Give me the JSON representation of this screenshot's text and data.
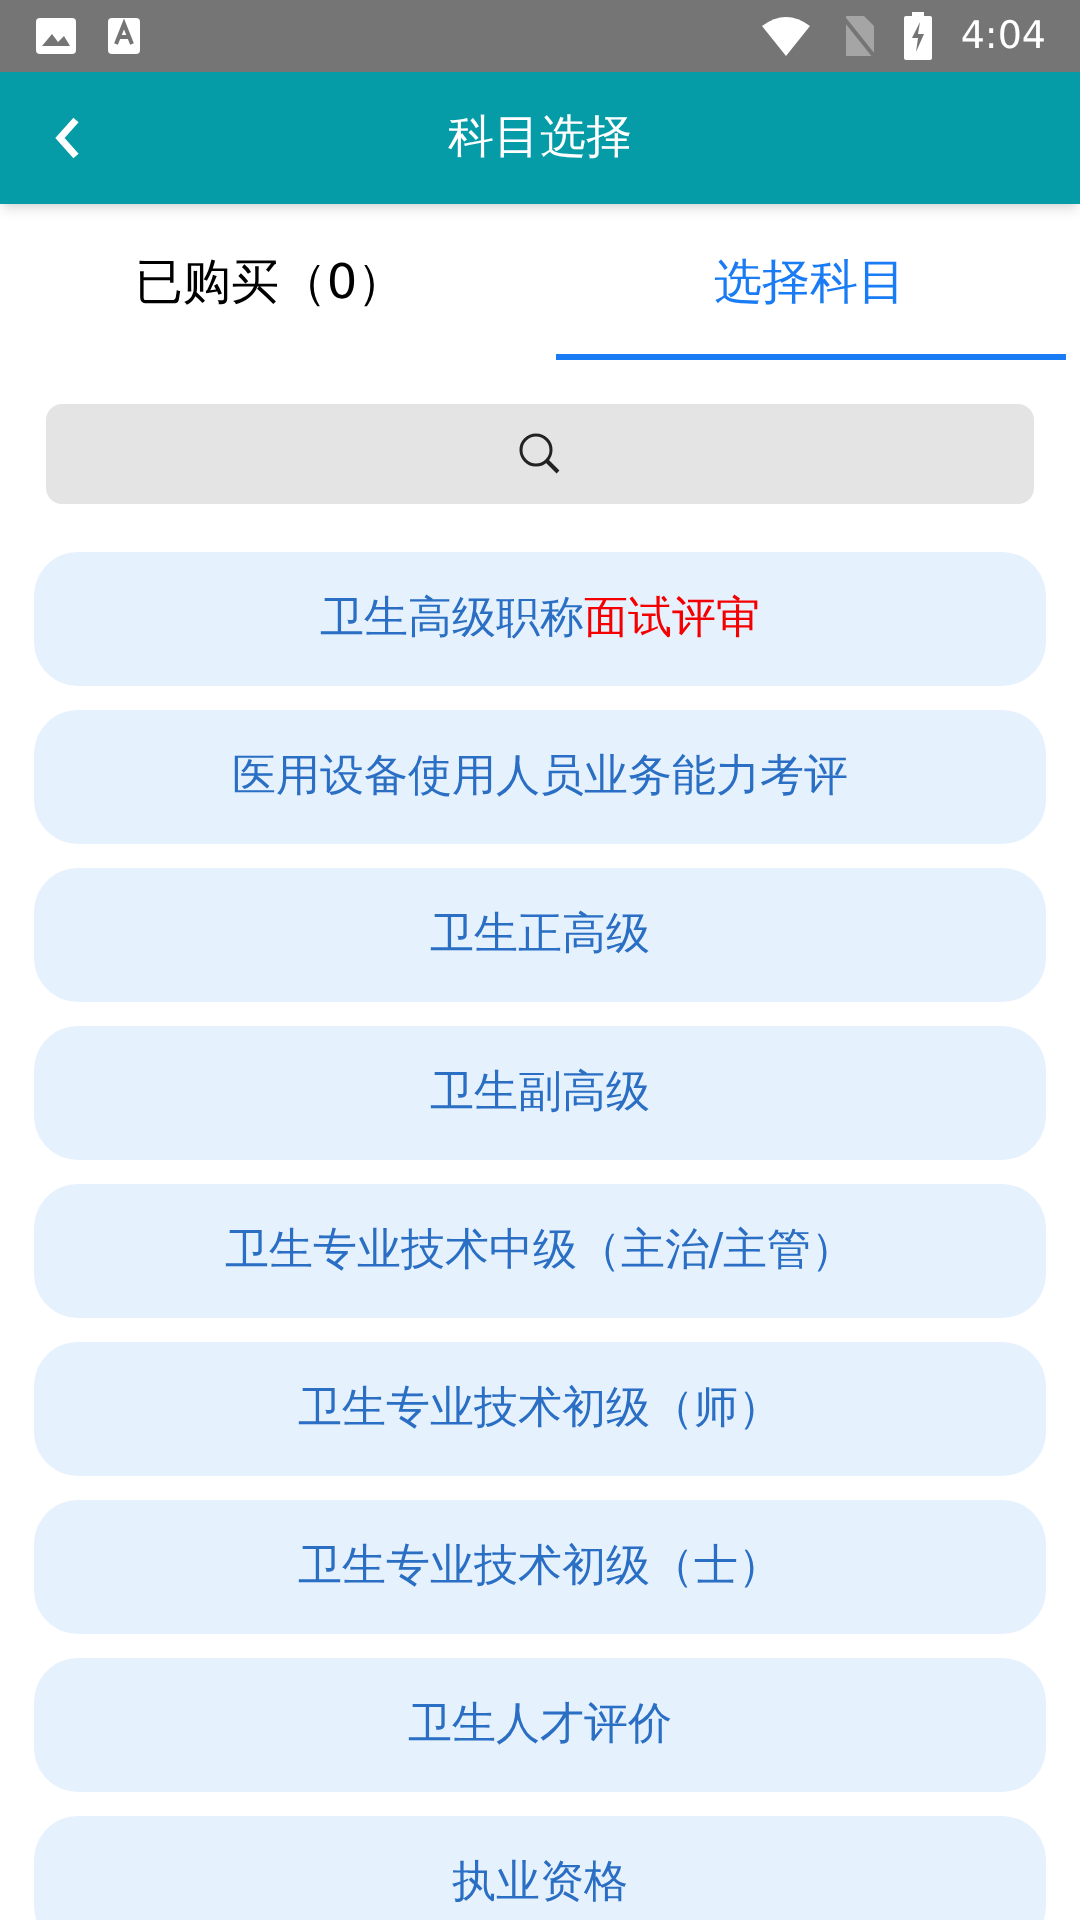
{
  "status_bar": {
    "time": "4:04"
  },
  "header": {
    "title": "科目选择"
  },
  "tabs": [
    {
      "label": "已购买（0）",
      "selected": false
    },
    {
      "label": "选择科目",
      "selected": true
    }
  ],
  "subjects": [
    {
      "label": "卫生高级职称",
      "highlight": "面试评审"
    },
    {
      "label": "医用设备使用人员业务能力考评"
    },
    {
      "label": "卫生正高级"
    },
    {
      "label": "卫生副高级"
    },
    {
      "label": "卫生专业技术中级（主治/主管）"
    },
    {
      "label": "卫生专业技术初级（师）"
    },
    {
      "label": "卫生专业技术初级（士）"
    },
    {
      "label": "卫生人才评价"
    },
    {
      "label": "执业资格"
    }
  ]
}
